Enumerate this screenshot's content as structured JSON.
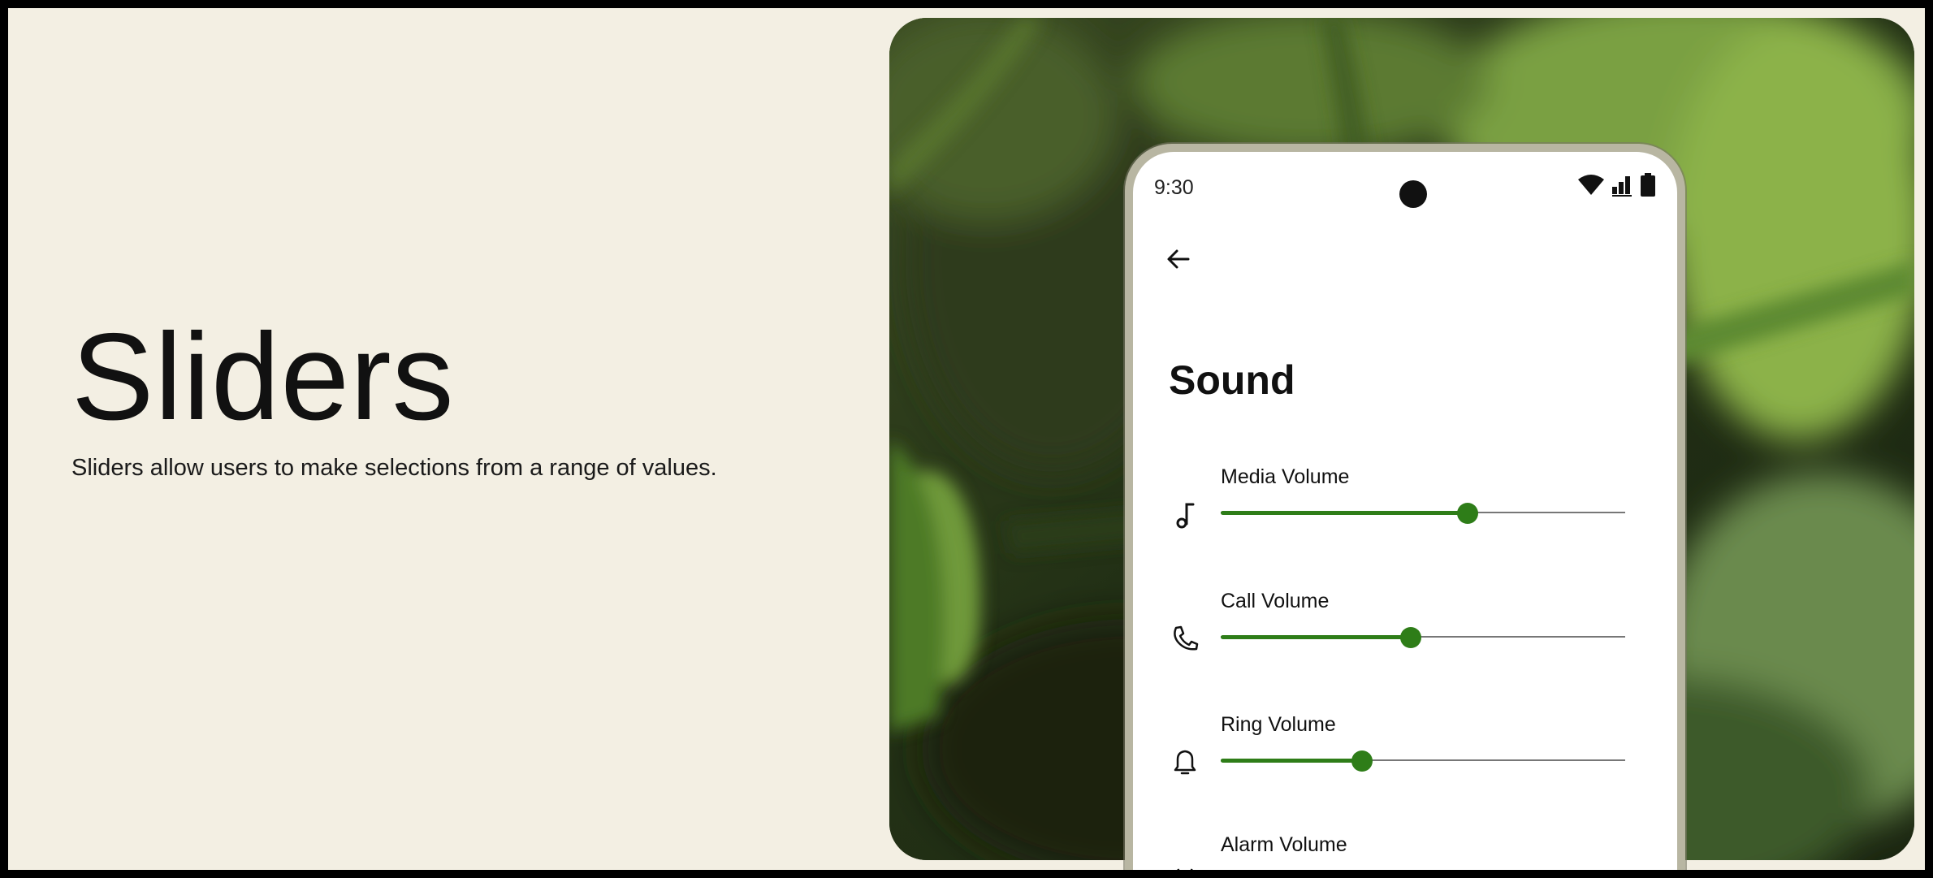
{
  "hero": {
    "title": "Sliders",
    "description": "Sliders allow users to make selections from a range of values."
  },
  "phone": {
    "status_time": "9:30",
    "status_icons": [
      "wifi-icon",
      "signal-icon",
      "battery-icon"
    ],
    "back_icon": "arrow-left-icon",
    "screen_title": "Sound",
    "sliders": [
      {
        "label": "Media Volume",
        "icon": "music-note-icon",
        "value": 0.61
      },
      {
        "label": "Call Volume",
        "icon": "phone-icon",
        "value": 0.47
      },
      {
        "label": "Ring Volume",
        "icon": "bell-icon",
        "value": 0.35
      },
      {
        "label": "Alarm Volume",
        "icon": "alarm-icon",
        "value": null
      }
    ]
  },
  "colors": {
    "page_background": "#f3efe3",
    "slider_active": "#2e7d18",
    "slider_track": "#777777",
    "phone_frame": "#b8b6a2"
  }
}
